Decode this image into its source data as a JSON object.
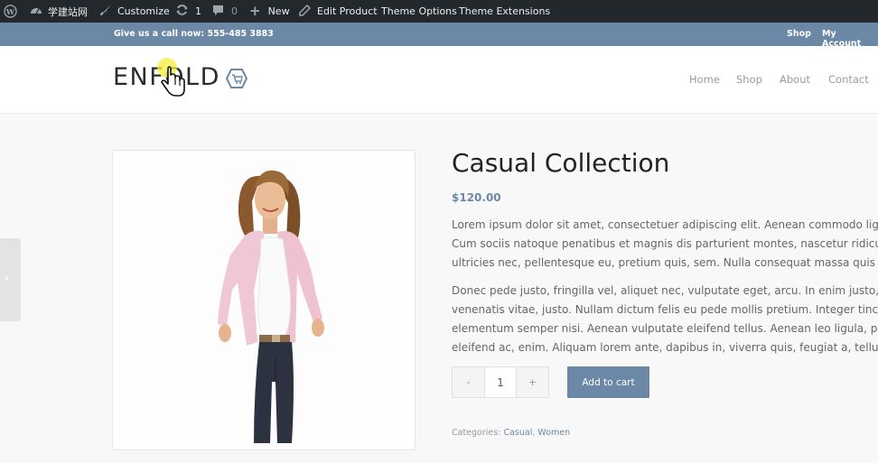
{
  "admin_bar": {
    "site_name": "学建站网",
    "customize": "Customize",
    "updates_count": "1",
    "comments_count": "0",
    "new": "New",
    "edit_product": "Edit Product",
    "theme_options": "Theme Options",
    "theme_extensions": "Theme Extensions"
  },
  "info_bar": {
    "phone": "Give us a call now: 555-485 3883",
    "links": [
      "Shop",
      "My Account"
    ]
  },
  "header": {
    "logo_text": "ENFOLD",
    "nav": [
      "Home",
      "Shop",
      "About",
      "Contact"
    ]
  },
  "product": {
    "title": "Casual Collection",
    "price": "$120.00",
    "description_lines_1": [
      "Lorem ipsum dolor sit amet, consectetuer adipiscing elit. Aenean commodo ligula eget dolor.",
      "Cum sociis natoque penatibus et magnis dis parturient montes, nascetur ridiculus mus.",
      "ultricies nec, pellentesque eu, pretium quis, sem. Nulla consequat massa quis enim."
    ],
    "description_lines_2": [
      "Donec pede justo, fringilla vel, aliquet nec, vulputate eget, arcu. In enim justo, rhoncus ut,",
      "venenatis vitae, justo. Nullam dictum felis eu pede mollis pretium. Integer tincidunt. Cras",
      "elementum semper nisi. Aenean vulputate eleifend tellus. Aenean leo ligula, porttitor eu,",
      "eleifend ac, enim. Aliquam lorem ante, dapibus in, viverra quis, feugiat a, tellus."
    ],
    "quantity": "1",
    "minus": "-",
    "plus": "+",
    "add_to_cart": "Add to cart",
    "categories_label": "Categories:",
    "categories": [
      "Casual",
      "Women"
    ]
  },
  "side_tab_glyph": "‹",
  "colors": {
    "accent": "#6b89a6",
    "admin_bar": "#23282d"
  }
}
